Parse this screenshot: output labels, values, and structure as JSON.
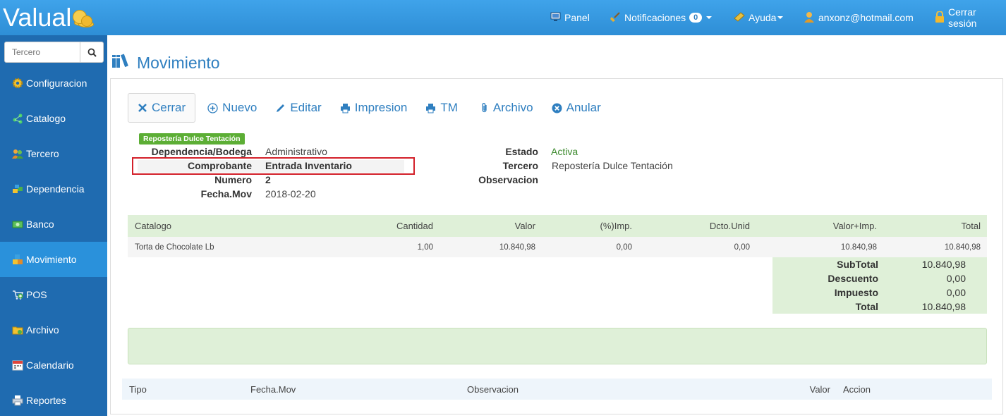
{
  "app": {
    "logo_text": "Valual",
    "colors": {
      "topbar": "#3a9ae0",
      "sidebar": "#1f6bb0",
      "sidebar_active": "#2a91db",
      "accent": "#2f7fc0",
      "success": "#5cae35",
      "table_green": "#dff0d8",
      "highlight": "#d3202a"
    }
  },
  "topnav": {
    "panel": {
      "label": "Panel",
      "icon": "monitor-icon"
    },
    "notificaciones": {
      "label": "Notificaciones",
      "count": "0",
      "icon": "broom-icon"
    },
    "ayuda": {
      "label": "Ayuda",
      "icon": "ticket-icon"
    },
    "user": {
      "label": "anxonz@hotmail.com",
      "icon": "user-icon"
    },
    "logout": {
      "label": "Cerrar sesión",
      "icon": "lock-icon"
    }
  },
  "sidebar": {
    "search_placeholder": "Tercero",
    "items": [
      {
        "label": "Configuracion",
        "icon": "gear-icon"
      },
      {
        "label": "Catalogo",
        "icon": "network-icon"
      },
      {
        "label": "Tercero",
        "icon": "users-icon"
      },
      {
        "label": "Dependencia",
        "icon": "blocks-icon"
      },
      {
        "label": "Banco",
        "icon": "money-icon"
      },
      {
        "label": "Movimiento",
        "icon": "boxes-icon",
        "active": true
      },
      {
        "label": "POS",
        "icon": "cart-add-icon"
      },
      {
        "label": "Archivo",
        "icon": "folder-icon"
      },
      {
        "label": "Calendario",
        "icon": "calendar-icon"
      },
      {
        "label": "Reportes",
        "icon": "printer-icon"
      }
    ]
  },
  "main": {
    "title": "Movimiento",
    "toolbar": {
      "cerrar": "Cerrar",
      "nuevo": "Nuevo",
      "editar": "Editar",
      "impresion": "Impresion",
      "tm": "TM",
      "archivo": "Archivo",
      "anular": "Anular"
    },
    "tag": "Repostería Dulce Tentación",
    "info": {
      "dependencia_label": "Dependencia/Bodega",
      "dependencia_value": "Administrativo",
      "comprobante_label": "Comprobante",
      "comprobante_value": "Entrada Inventario",
      "numero_label": "Numero",
      "numero_value": "2",
      "fecha_label": "Fecha.Mov",
      "fecha_value": "2018-02-20",
      "estado_label": "Estado",
      "estado_value": "Activa",
      "tercero_label": "Tercero",
      "tercero_value": "Repostería Dulce Tentación",
      "observacion_label": "Observacion",
      "observacion_value": ""
    },
    "detail_table": {
      "headers": [
        "Catalogo",
        "Cantidad",
        "Valor",
        "(%)Imp.",
        "Dcto.Unid",
        "Valor+Imp.",
        "Total"
      ],
      "rows": [
        [
          "Torta de Chocolate Lb",
          "1,00",
          "10.840,98",
          "0,00",
          "0,00",
          "10.840,98",
          "10.840,98"
        ]
      ]
    },
    "totals": {
      "subtotal_label": "SubTotal",
      "subtotal_value": "10.840,98",
      "descuento_label": "Descuento",
      "descuento_value": "0,00",
      "impuesto_label": "Impuesto",
      "impuesto_value": "0,00",
      "total_label": "Total",
      "total_value": "10.840,98"
    },
    "payments_table": {
      "headers": [
        "Tipo",
        "Fecha.Mov",
        "Observacion",
        "Valor",
        "Accion"
      ]
    }
  }
}
